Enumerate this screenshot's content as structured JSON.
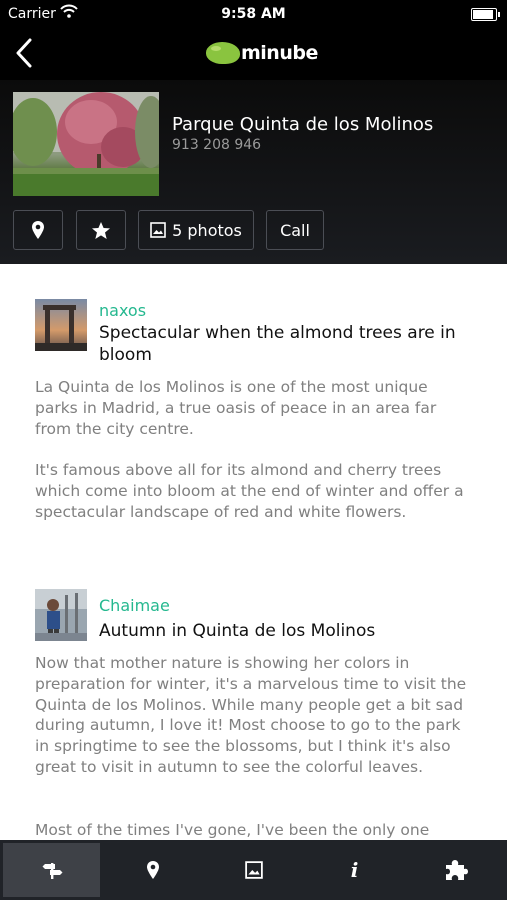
{
  "status_bar": {
    "carrier": "Carrier",
    "time": "9:58 AM"
  },
  "nav": {
    "logo_text": "minube",
    "back_icon": "chevron-left-icon",
    "logo_color": "#8ac43f"
  },
  "place": {
    "title": "Parque Quinta de los Molinos",
    "phone": "913 208 946",
    "buttons": {
      "location_icon": "map-pin-icon",
      "favorite_icon": "star-icon",
      "photos_label": "5 photos",
      "call_label": "Call"
    }
  },
  "reviews": [
    {
      "author": "naxos",
      "title": "Spectacular when the almond trees are in bloom",
      "paragraphs": [
        "La Quinta de los Molinos is one of the most unique parks in Madrid, a true oasis of peace in an area far from the city centre.",
        "It's famous above all for its almond and cherry trees which come into bloom at the end of winter and offer a spectacular landscape of red and white flowers."
      ]
    },
    {
      "author": "Chaimae",
      "title": "Autumn in Quinta de los Molinos",
      "paragraphs": [
        "Now that mother nature is showing her colors in preparation for winter, it's a marvelous time to visit the Quinta de los Molinos. While many people get a bit sad during autumn, I love it! Most choose to go to the park in springtime to see the blossoms, but I think it's also great to visit in autumn to see the colorful leaves.",
        "Most of the times I've gone, I've been the only one"
      ]
    }
  ],
  "tabs": [
    {
      "icon": "signpost-icon",
      "active": true
    },
    {
      "icon": "map-pin-icon",
      "active": false
    },
    {
      "icon": "photo-icon",
      "active": false
    },
    {
      "icon": "info-icon",
      "label": "i",
      "active": false
    },
    {
      "icon": "puzzle-icon",
      "active": false
    }
  ],
  "colors": {
    "accent": "#25b88f",
    "tab_bar": "#202328",
    "tab_active": "#3e4147",
    "body_text": "#808080"
  }
}
